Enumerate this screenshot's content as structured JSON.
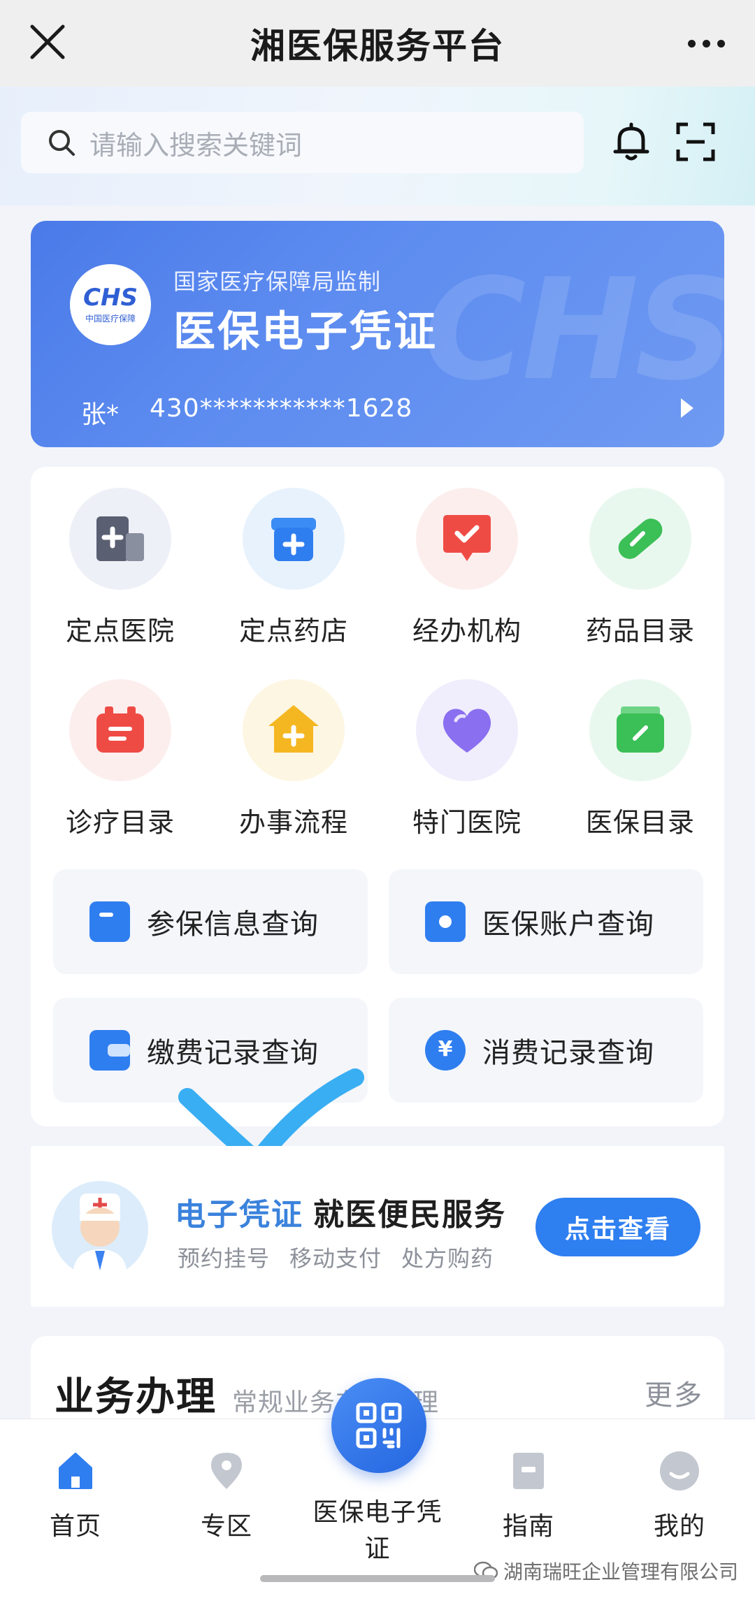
{
  "topbar": {
    "title": "湘医保服务平台"
  },
  "search": {
    "placeholder": "请输入搜索关键词"
  },
  "card": {
    "subtitle": "国家医疗保障局监制",
    "title": "医保电子凭证",
    "logo_text": "CHS",
    "logo_sub": "中国医疗保障",
    "name": "张*",
    "id_number": "430***********1628"
  },
  "grid": [
    {
      "label": "定点医院",
      "icon": "hospital-icon",
      "color": "#5a5f72",
      "bg": "#eef0f7"
    },
    {
      "label": "定点药店",
      "icon": "pharmacy-icon",
      "color": "#2f7ef0",
      "bg": "#e8f2fd"
    },
    {
      "label": "经办机构",
      "icon": "agency-icon",
      "color": "#ef4b45",
      "bg": "#fdeeee"
    },
    {
      "label": "药品目录",
      "icon": "pill-icon",
      "color": "#3bbf57",
      "bg": "#e9f8ee"
    },
    {
      "label": "诊疗目录",
      "icon": "treatment-icon",
      "color": "#ef4b45",
      "bg": "#fdeeee"
    },
    {
      "label": "办事流程",
      "icon": "process-icon",
      "color": "#f5b721",
      "bg": "#fdf6e2"
    },
    {
      "label": "特门医院",
      "icon": "heart-icon",
      "color": "#8a6ff0",
      "bg": "#f0edfc"
    },
    {
      "label": "医保目录",
      "icon": "catalog-icon",
      "color": "#3bbf57",
      "bg": "#e9f8ee"
    }
  ],
  "queries": [
    {
      "label": "参保信息查询",
      "icon": "insurance-info-icon"
    },
    {
      "label": "医保账户查询",
      "icon": "account-icon"
    },
    {
      "label": "缴费记录查询",
      "icon": "payment-record-icon"
    },
    {
      "label": "消费记录查询",
      "icon": "consumption-record-icon"
    }
  ],
  "service": {
    "highlight": "电子凭证",
    "title": "就医便民服务",
    "tags": [
      "预约挂号",
      "移动支付",
      "处方购药"
    ],
    "button": "点击查看"
  },
  "business": {
    "title": "业务办理",
    "subtitle": "常规业务在线办理",
    "more": "更多"
  },
  "tabbar": {
    "home": "首页",
    "zone": "专区",
    "center": "医保电子凭证",
    "guide": "指南",
    "mine": "我的"
  },
  "watermark": "湖南瑞旺企业管理有限公司",
  "colors": {
    "accent": "#2e7ff0",
    "check_mark": "#39aef2"
  }
}
